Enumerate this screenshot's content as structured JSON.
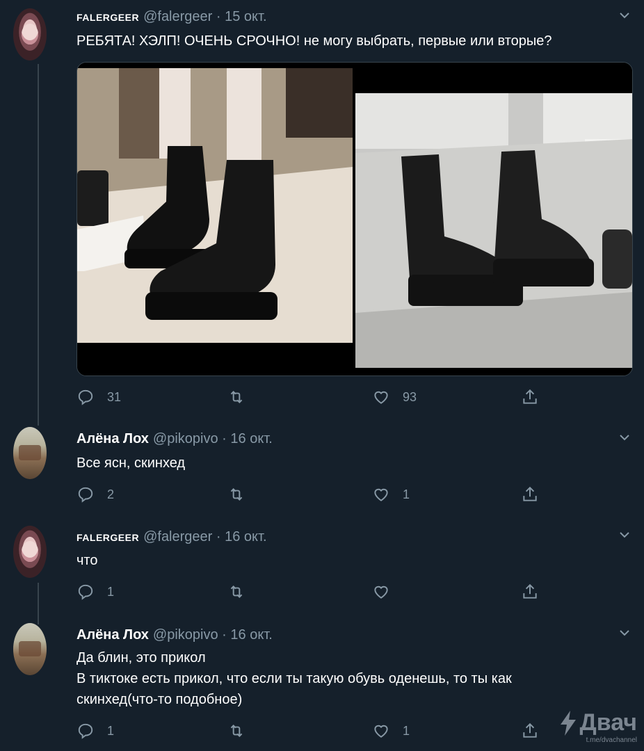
{
  "tweets": [
    {
      "name": "FALERGEER",
      "handle": "@falergeer",
      "date": "15 окт.",
      "lines": [
        "РЕБЯТА! ХЭЛП! ОЧЕНЬ СРОЧНО! не могу выбрать, первые или вторые?"
      ],
      "reply": "31",
      "retweet": "",
      "like": "93"
    },
    {
      "name": "Алёна Лох",
      "handle": "@pikopivo",
      "date": "16 окт.",
      "lines": [
        "Все ясн, скинхед"
      ],
      "reply": "2",
      "retweet": "",
      "like": "1"
    },
    {
      "name": "FALERGEER",
      "handle": "@falergeer",
      "date": "16 окт.",
      "lines": [
        "что"
      ],
      "reply": "1",
      "retweet": "",
      "like": ""
    },
    {
      "name": "Алёна Лох",
      "handle": "@pikopivo",
      "date": "16 окт.",
      "lines": [
        "Да блин, это прикол",
        "В тиктоке есть прикол, что если ты такую обувь оденешь, то ты как",
        "скинхед(что-то подобное)"
      ],
      "reply": "1",
      "retweet": "",
      "like": "1"
    }
  ],
  "separator": "·",
  "watermark": {
    "logo": "Двач",
    "sub": "t.me/dvachannel"
  },
  "colors": {
    "background": "#15202b",
    "text": "#ffffff",
    "muted": "#8899a6",
    "line": "#38444d"
  }
}
